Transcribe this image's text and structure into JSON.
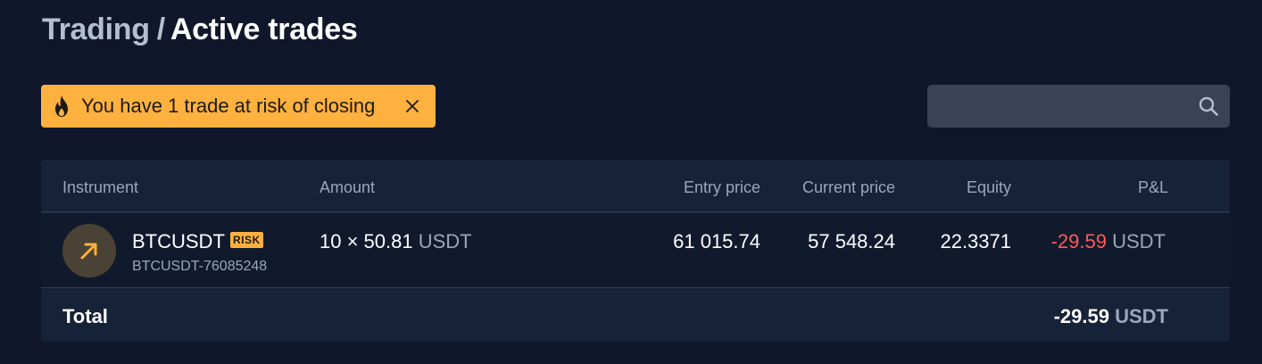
{
  "breadcrumb": {
    "parent": "Trading",
    "separator": "/",
    "current": "Active trades"
  },
  "alert": {
    "text": "You have 1 trade at risk of closing",
    "icon": "flame-icon",
    "close_icon": "close-icon"
  },
  "search": {
    "value": "",
    "placeholder": "",
    "icon": "search-icon"
  },
  "table": {
    "headers": {
      "instrument": "Instrument",
      "amount": "Amount",
      "entry_price": "Entry price",
      "current_price": "Current price",
      "equity": "Equity",
      "pnl": "P&L"
    },
    "rows": [
      {
        "icon": "arrow-up-right-icon",
        "instrument": "BTCUSDT",
        "badge": "RISK",
        "trade_id": "BTCUSDT-76085248",
        "amount": "10 × 50.81",
        "amount_unit": "USDT",
        "entry_price": "61 015.74",
        "current_price": "57 548.24",
        "equity": "22.3371",
        "pnl": "-29.59",
        "pnl_unit": "USDT"
      }
    ],
    "total": {
      "label": "Total",
      "value": "-29.59",
      "unit": "USDT"
    }
  },
  "colors": {
    "background": "#10172a",
    "alert": "#ffb13f",
    "negative": "#ff5a5a",
    "muted": "#9aa6bb"
  }
}
